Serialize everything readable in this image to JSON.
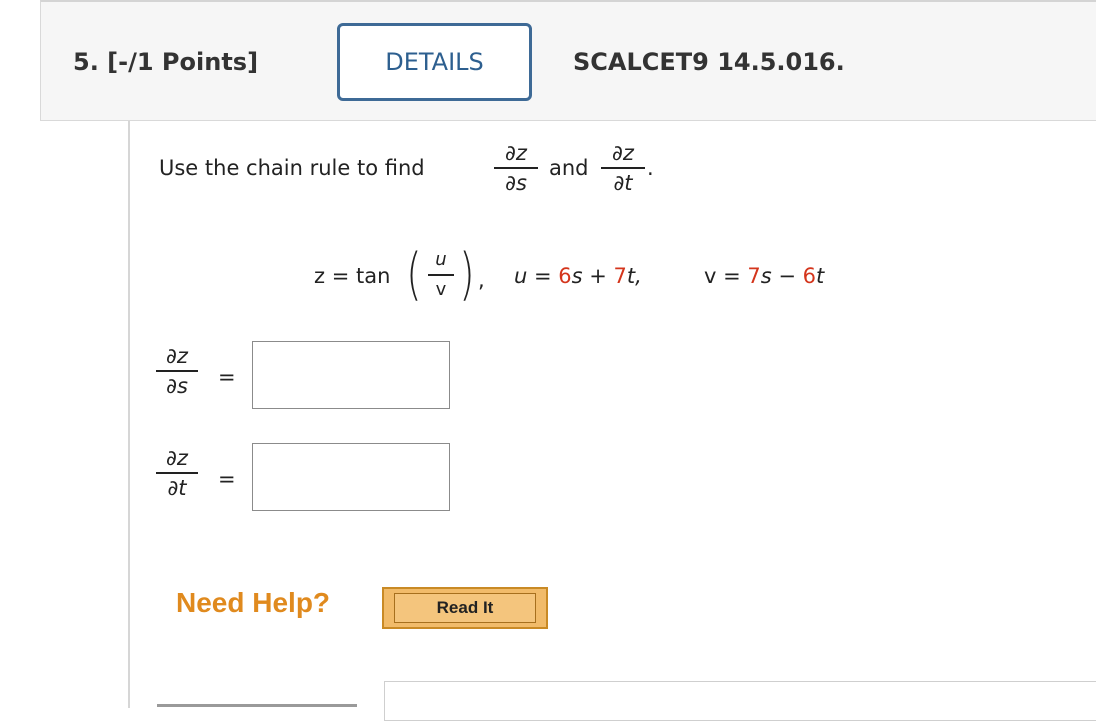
{
  "header": {
    "question_label": "5.  [-/1 Points]",
    "details_label": "DETAILS",
    "code": "SCALCET9 14.5.016."
  },
  "prompt": {
    "text": "Use the chain rule to find",
    "and": "and",
    "d1_top": "∂z",
    "d1_bot": "∂s",
    "d2_top": "∂z",
    "d2_bot": "∂t",
    "period": "."
  },
  "equation": {
    "z_part": "z = tan",
    "frac_top": "u",
    "frac_bot": "v",
    "comma": ",",
    "u_part": "u = ",
    "u_c1": "6",
    "u_mid": "s + ",
    "u_c2": "7",
    "u_end": "t,",
    "v_part": "v = ",
    "v_c1": "7",
    "v_mid": "s − ",
    "v_c2": "6",
    "v_end": "t"
  },
  "answers": [
    {
      "top": "∂z",
      "bot": "∂s",
      "equals": "=",
      "value": ""
    },
    {
      "top": "∂z",
      "bot": "∂t",
      "equals": "=",
      "value": ""
    }
  ],
  "help": {
    "label": "Need Help?",
    "read_it": "Read It"
  },
  "colors": {
    "accent": "#2d5f8f",
    "coefficient": "#d4351c",
    "help": "#e08a1e",
    "button": "#f1bb6a"
  }
}
